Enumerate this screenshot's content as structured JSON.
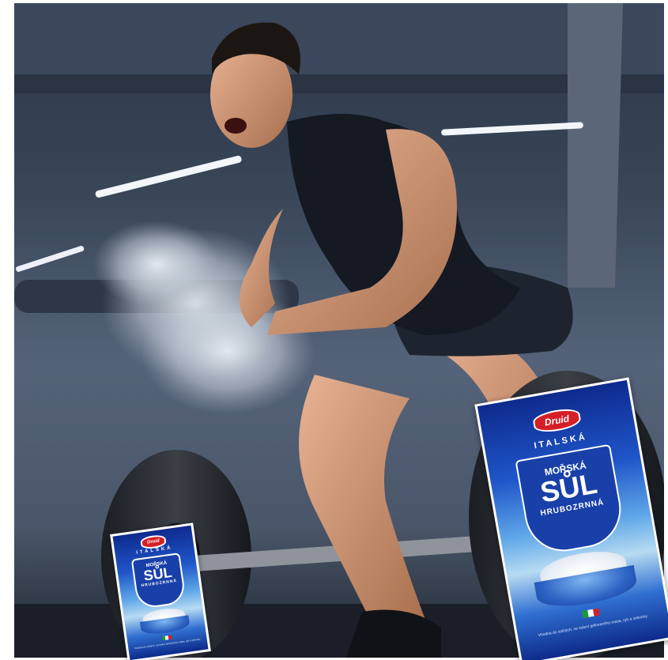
{
  "photo": {
    "description_icon": "gym-deadlift-photo-icon"
  },
  "packages": {
    "brand": "Druid",
    "italska": "ITALSKÁ",
    "morska": "MOŘSKÁ",
    "sul": "SŮL",
    "hrubozrnna": "HRUBOZRNNÁ",
    "small_text": "Vhodná do solných, na solení grilovaného masa, ryb a zeleniny."
  },
  "colors": {
    "pack_blue": "#1840a8",
    "brand_red": "#d51f26"
  }
}
